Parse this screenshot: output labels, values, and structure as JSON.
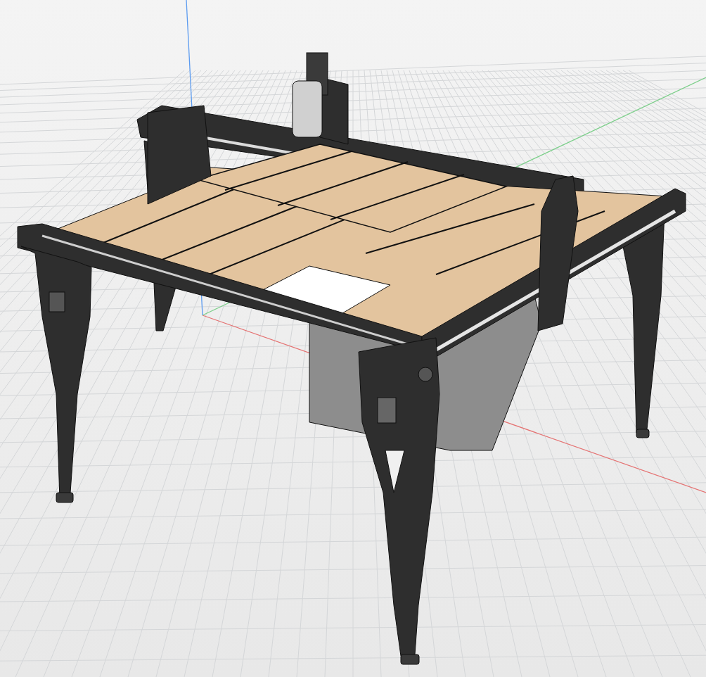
{
  "viewport": {
    "axes": [
      {
        "kind": "x",
        "color": "#e57373"
      },
      {
        "kind": "y",
        "color": "#7ccf8a"
      },
      {
        "kind": "z",
        "color": "#5b9bf0"
      }
    ]
  }
}
